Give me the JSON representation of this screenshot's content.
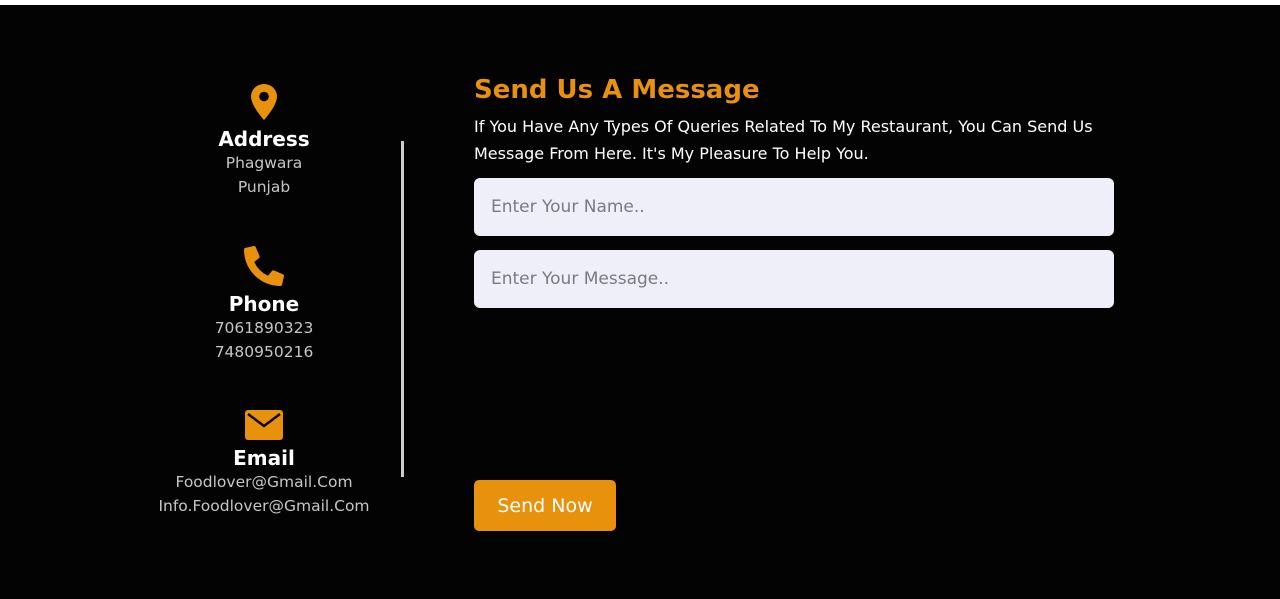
{
  "contact_info": {
    "address": {
      "icon": "location-pin-icon",
      "title": "Address",
      "lines": [
        "Phagwara",
        "Punjab"
      ]
    },
    "phone": {
      "icon": "phone-icon",
      "title": "Phone",
      "lines": [
        "7061890323",
        "7480950216"
      ]
    },
    "email": {
      "icon": "envelope-icon",
      "title": "Email",
      "lines": [
        "Foodlover@Gmail.Com",
        "Info.Foodlover@Gmail.Com"
      ]
    }
  },
  "form": {
    "title": "Send Us A Message",
    "description": "If You Have Any Types Of Queries Related To My Restaurant, You Can Send Us Message From Here. It's My Pleasure To Help You.",
    "name_input": {
      "placeholder": "Enter Your Name..",
      "value": ""
    },
    "message_input": {
      "placeholder": "Enter Your Message..",
      "value": ""
    },
    "submit_label": "Send Now"
  },
  "colors": {
    "background": "#030303",
    "accent": "#e8910c",
    "input_background": "#eeeff8",
    "divider": "#cfcfcf"
  }
}
